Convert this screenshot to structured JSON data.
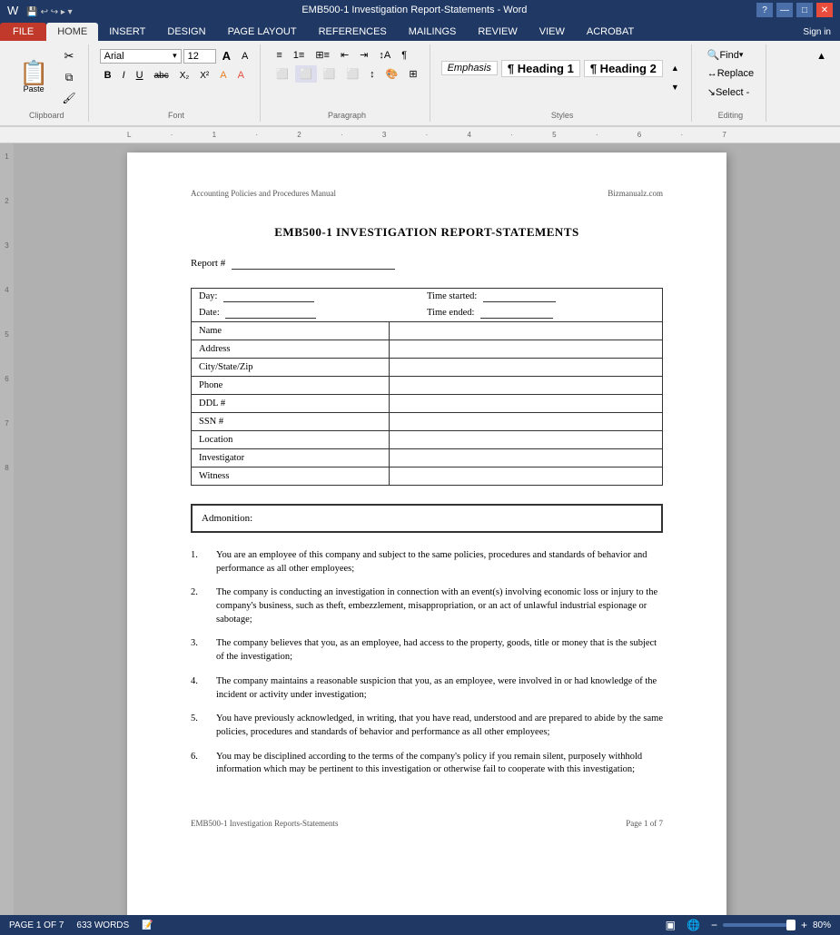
{
  "titleBar": {
    "title": "EMB500-1 Investigation Report-Statements - Word",
    "helpBtn": "?",
    "minimizeBtn": "—",
    "maximizeBtn": "□",
    "closeBtn": "✕"
  },
  "ribbon": {
    "tabs": [
      "FILE",
      "HOME",
      "INSERT",
      "DESIGN",
      "PAGE LAYOUT",
      "REFERENCES",
      "MAILINGS",
      "REVIEW",
      "VIEW",
      "ACROBAT"
    ],
    "activeTab": "HOME",
    "signIn": "Sign in",
    "clipboard": {
      "label": "Clipboard",
      "paste": "Paste"
    },
    "font": {
      "label": "Font",
      "name": "Arial",
      "size": "12",
      "boldBtn": "B",
      "italicBtn": "I",
      "underlineBtn": "U"
    },
    "paragraph": {
      "label": "Paragraph"
    },
    "styles": {
      "label": "Styles",
      "items": [
        "Emphasis",
        "¶ Heading 1",
        "¶ Heading 2"
      ]
    },
    "editing": {
      "label": "Editing",
      "find": "Find",
      "replace": "Replace",
      "select": "Select -"
    }
  },
  "document": {
    "headerLeft": "Accounting Policies and Procedures Manual",
    "headerRight": "Bizmanualz.com",
    "title": "EMB500-1 INVESTIGATION REPORT-STATEMENTS",
    "reportLabel": "Report #",
    "dayLabel": "Day:",
    "dateLabel": "Date:",
    "timeStartedLabel": "Time started:",
    "timeEndedLabel": "Time ended:",
    "tableRows": [
      {
        "label": "Name",
        "value": ""
      },
      {
        "label": "Address",
        "value": ""
      },
      {
        "label": "City/State/Zip",
        "value": ""
      },
      {
        "label": "Phone",
        "value": ""
      },
      {
        "label": "DDL #",
        "value": ""
      },
      {
        "label": "SSN #",
        "value": ""
      },
      {
        "label": "Location",
        "value": ""
      },
      {
        "label": "Investigator",
        "value": ""
      },
      {
        "label": "Witness",
        "value": ""
      }
    ],
    "admonitionLabel": "Admonition:",
    "listItems": [
      "You are an employee of this company and subject to the same policies, procedures and standards of behavior and performance as all other employees;",
      "The company is conducting an investigation in connection with an event(s) involving economic loss or injury to the company's business, such as theft, embezzlement, misappropriation, or an act of unlawful industrial espionage or sabotage;",
      "The company believes that you, as an employee, had access to the property, goods, title or money that is the subject of the investigation;",
      "The company maintains a reasonable suspicion that you, as an employee, were involved in or had knowledge of the incident or activity under investigation;",
      "You have previously acknowledged, in writing, that you have read, understood and are prepared to abide by the same policies, procedures and standards of behavior and performance as all other employees;",
      "You may be disciplined according to the terms of the company's policy if you remain silent, purposely withhold information which may be pertinent to this investigation or otherwise fail to cooperate with this investigation;"
    ],
    "footerLeft": "EMB500-1 Investigation Reports-Statements",
    "footerRight": "Page 1 of 7"
  },
  "statusBar": {
    "pageInfo": "PAGE 1 OF 7",
    "wordCount": "633 WORDS",
    "zoom": "80%"
  }
}
